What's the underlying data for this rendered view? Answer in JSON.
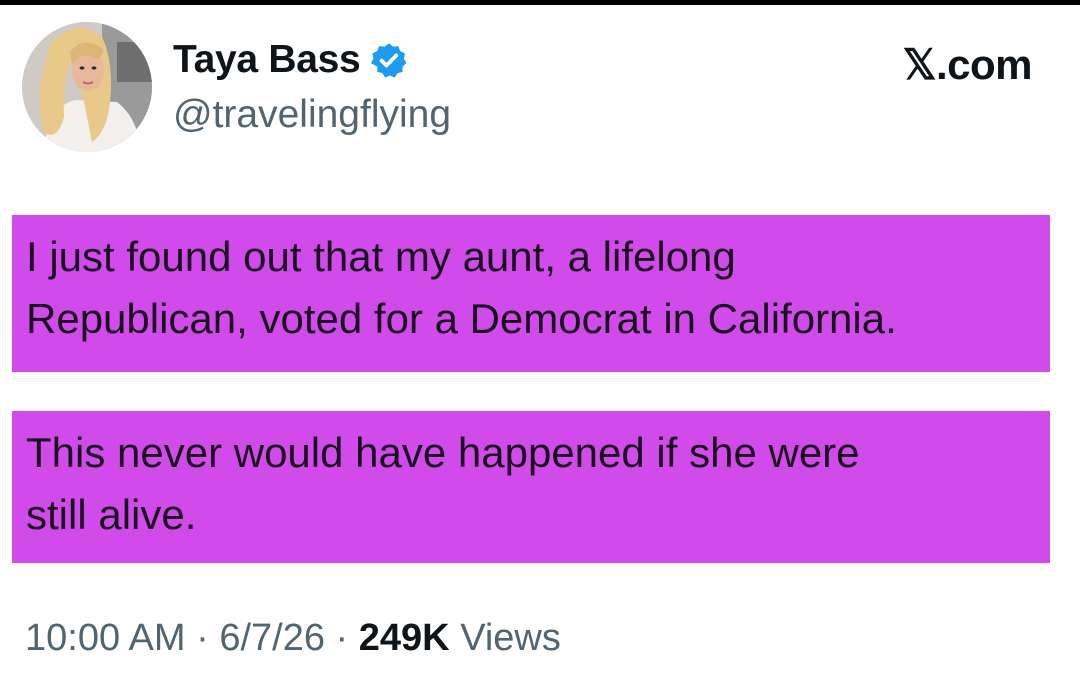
{
  "brand": "𝕏.com",
  "author": {
    "display_name": "Taya Bass",
    "handle": "@travelingflying",
    "verified": true,
    "verified_badge_color": "#1d9bf0"
  },
  "tweet": {
    "highlight_color": "#d04be9",
    "paragraphs": [
      {
        "lines": [
          "I just found out that my aunt, a lifelong",
          "Republican, voted for a Democrat in California."
        ]
      },
      {
        "lines": [
          "This never would have happened if she were",
          "still alive."
        ]
      }
    ]
  },
  "meta": {
    "time": "10:00 AM",
    "separator": " · ",
    "date": "6/7/26",
    "views_count": "249K",
    "views_label": "Views"
  },
  "icons": {
    "avatar": "profile-photo",
    "verified": "verified-badge-icon"
  }
}
